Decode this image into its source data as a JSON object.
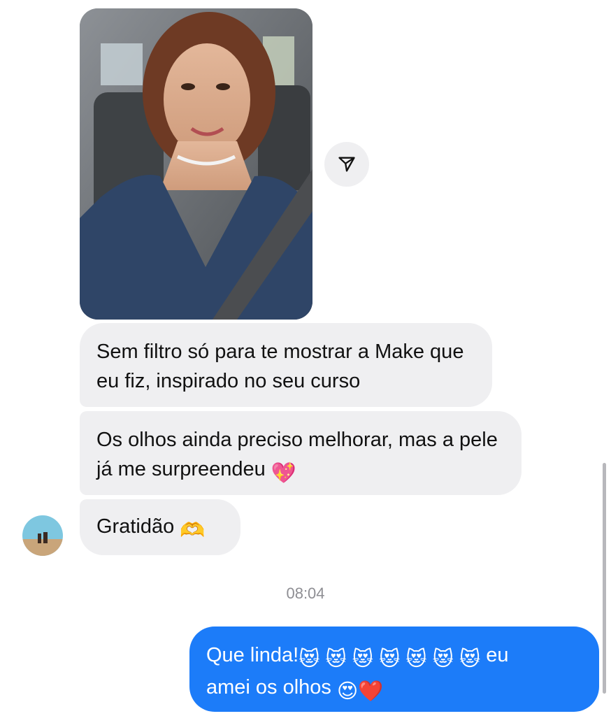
{
  "messages_in": {
    "photo_alt_icon": "selfie-photo",
    "share_icon": "paper-plane-icon",
    "msg1": "Sem filtro só para te mostrar a Make que eu fiz, inspirado no seu curso",
    "msg2_text": "Os olhos ainda preciso melhorar, mas a pele já me surpreendeu",
    "msg2_emoji": "💖",
    "msg3_text": "Gratidão",
    "msg3_emoji": "🫶"
  },
  "timestamp": "08:04",
  "message_out": {
    "line1_text": "Que linda!",
    "emojis": "😻 😻 😻 😻 😻 😻 😻",
    "line1_tail": "eu",
    "line2_text": "amei os olhos",
    "line2_emojis": "😍❤️"
  },
  "colors": {
    "incoming_bubble": "#efeff1",
    "outgoing_bubble": "#1c7cf9",
    "timestamp": "#8e8e93"
  }
}
